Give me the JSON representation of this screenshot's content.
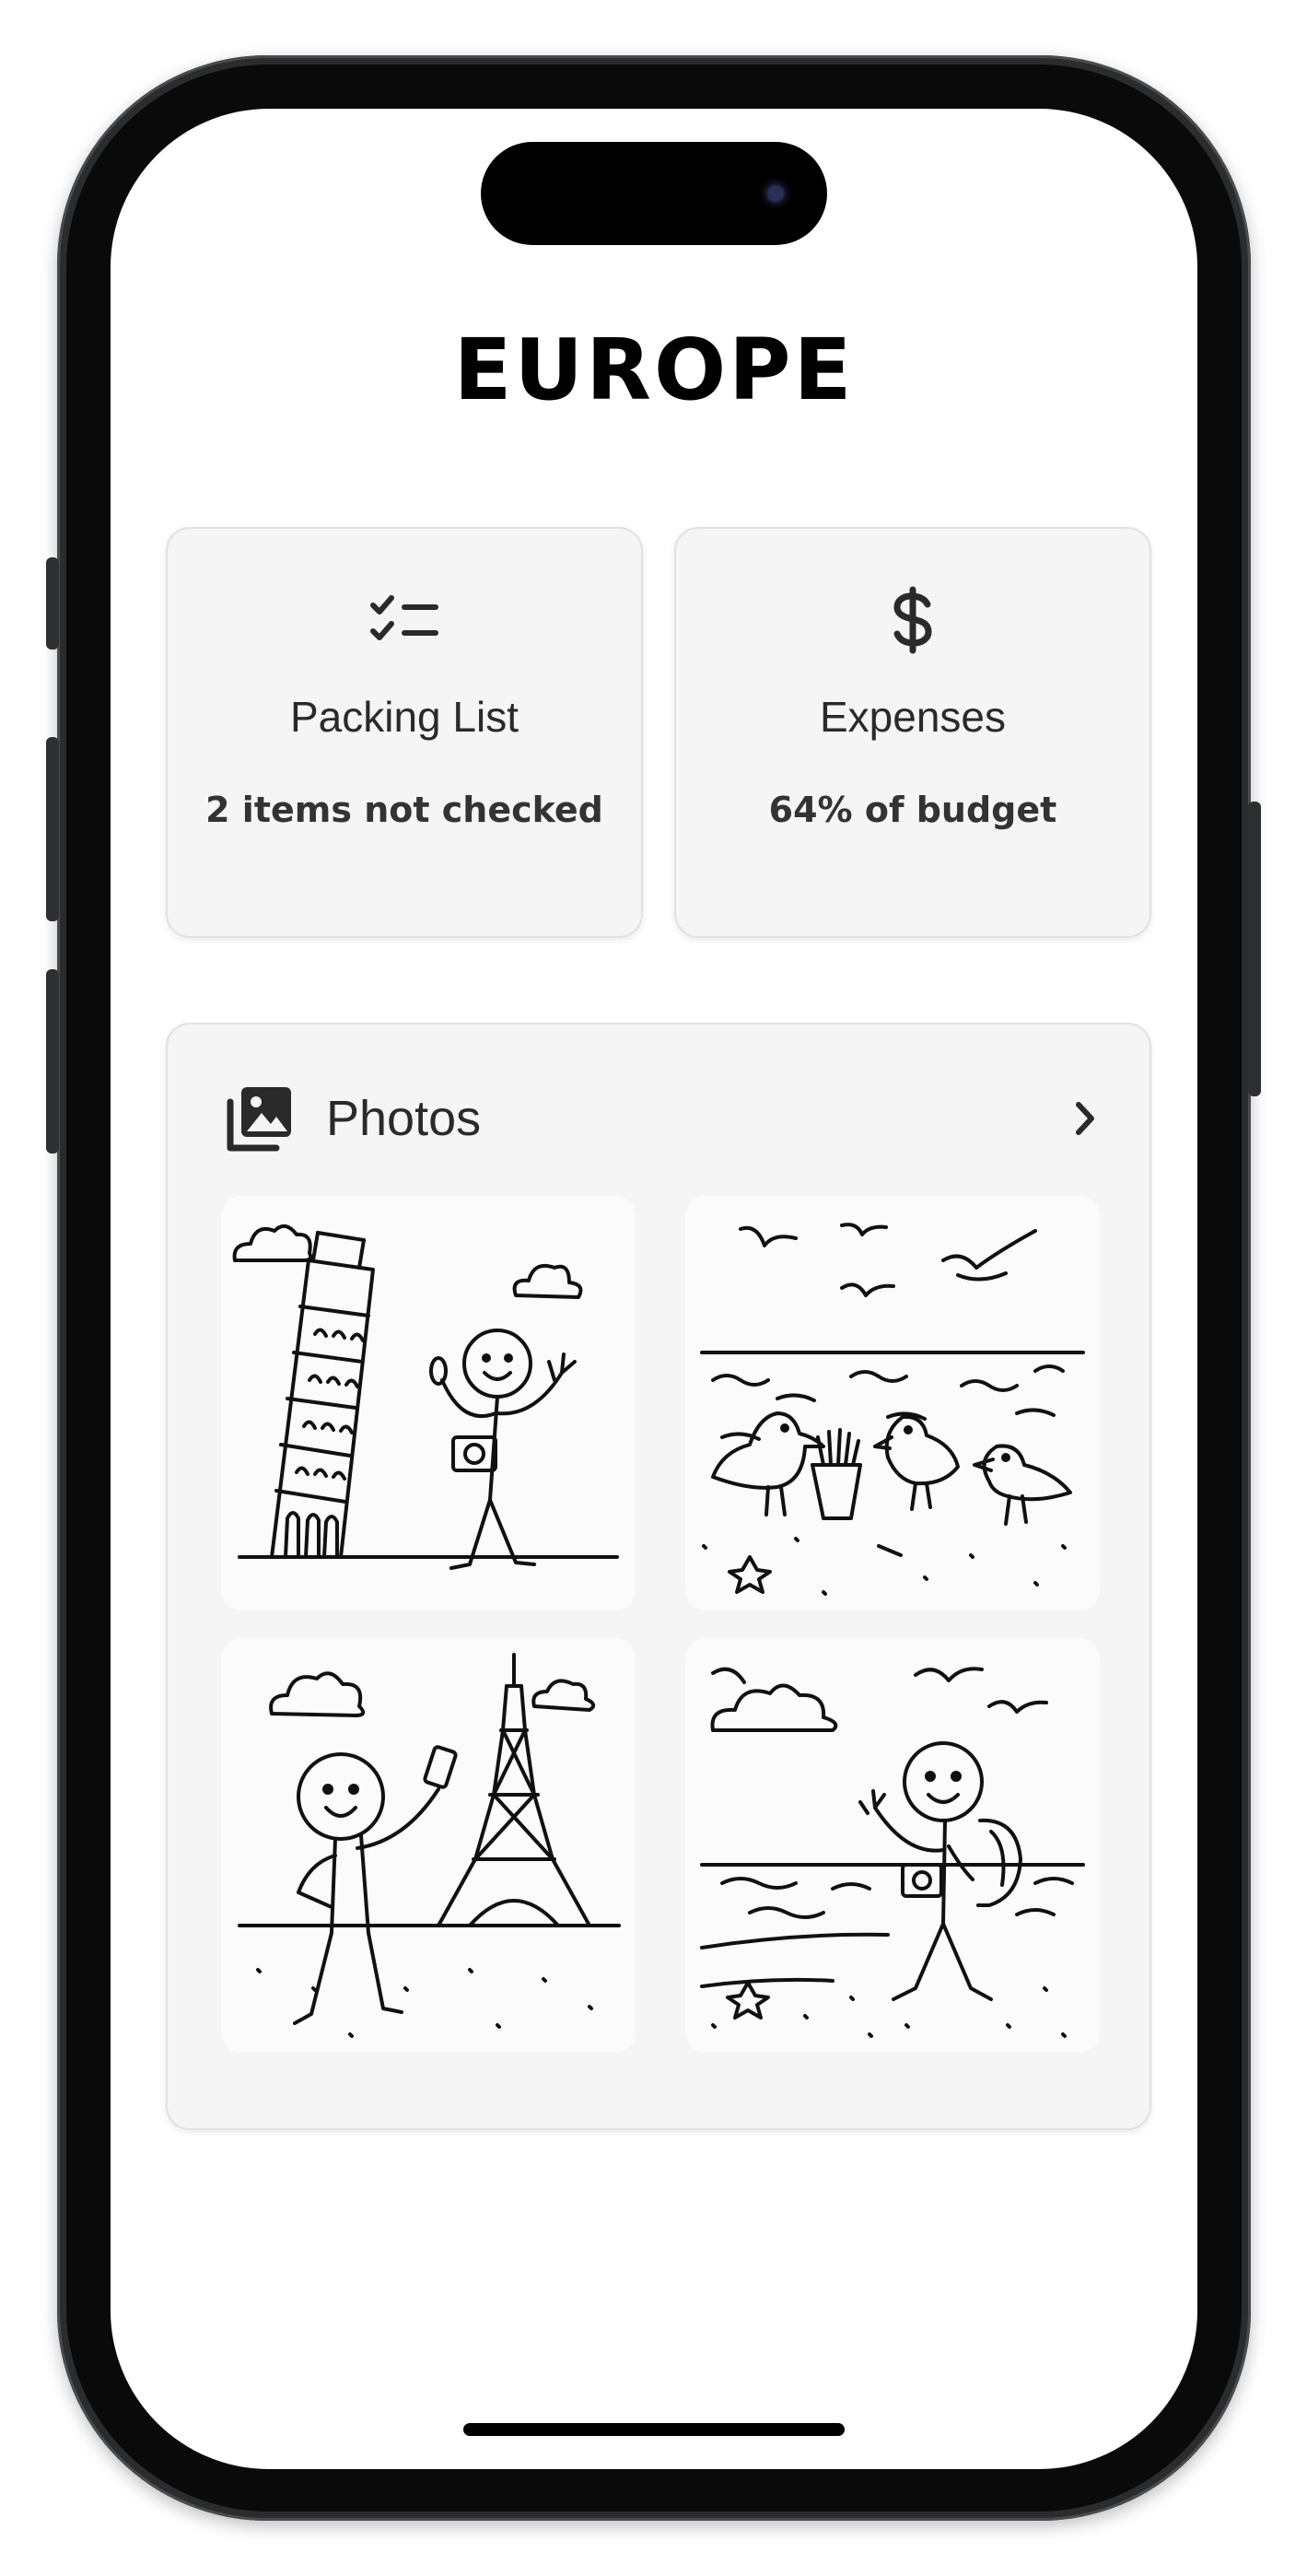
{
  "app": {
    "title": "EUROPE"
  },
  "tiles": [
    {
      "id": "packing",
      "icon": "checklist-icon",
      "title": "Packing List",
      "subtitle": "2 items not checked"
    },
    {
      "id": "expenses",
      "icon": "dollar-sign-icon",
      "title": "Expenses",
      "subtitle": "64% of budget",
      "budget_used_percent": 64
    }
  ],
  "photos": {
    "title": "Photos",
    "icon": "photo-stack-icon",
    "action_icon": "chevron-right-icon",
    "items": [
      {
        "icon": "leaning-tower-illustration"
      },
      {
        "icon": "seagulls-beach-illustration"
      },
      {
        "icon": "eiffel-tower-illustration"
      },
      {
        "icon": "beach-backpacker-illustration"
      }
    ]
  },
  "colors": {
    "background": "#ffffff",
    "card": "#f5f5f5",
    "text": "#2a2a2a",
    "title": "#000000",
    "frame": "#0a0a0a"
  }
}
